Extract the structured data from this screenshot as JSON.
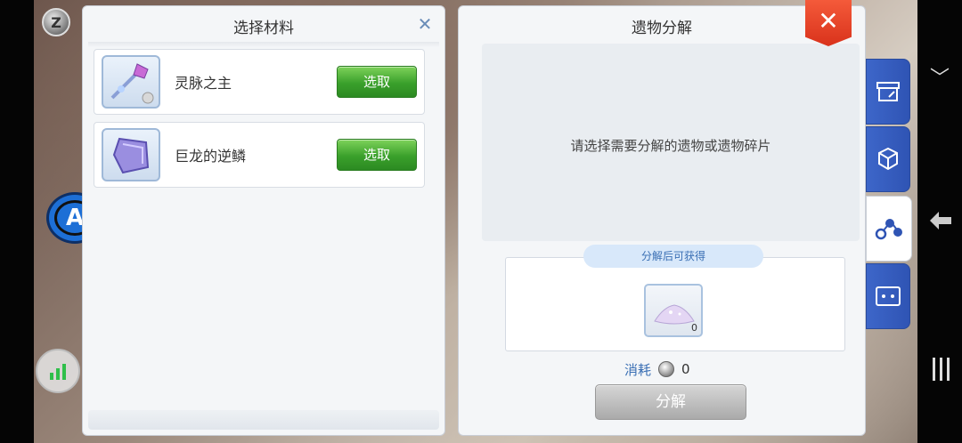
{
  "left_panel": {
    "title": "选择材料",
    "items": [
      {
        "name": "灵脉之主",
        "button": "选取"
      },
      {
        "name": "巨龙的逆鳞",
        "button": "选取"
      }
    ]
  },
  "right_panel": {
    "title": "遗物分解",
    "message": "请选择需要分解的遗物或遗物碎片",
    "result_label": "分解后可获得",
    "result_count": "0",
    "cost_label": "消耗",
    "cost_value": "0",
    "action_button": "分解"
  },
  "hud": {
    "a_button": "A",
    "z_coin": "Z"
  },
  "side_tabs": [
    {
      "icon": "shop-icon"
    },
    {
      "icon": "cubes-icon"
    },
    {
      "icon": "molecule-icon",
      "active": true
    },
    {
      "icon": "id-frame-icon"
    }
  ],
  "colors": {
    "select_button": "#3aa02b",
    "close_red": "#d9321b",
    "tab_blue": "#2f54b4",
    "label_blue": "#3a6fb4"
  }
}
